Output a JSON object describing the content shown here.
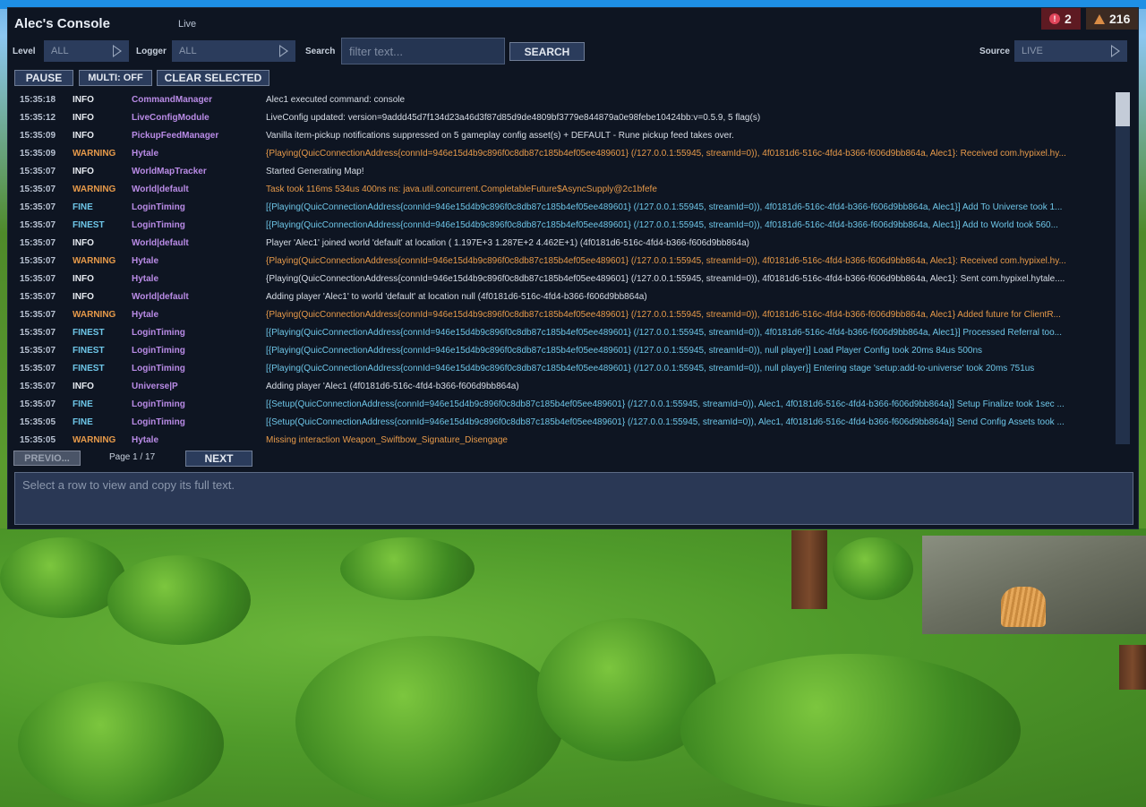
{
  "app": {
    "title": "Alec's Console",
    "status": "Live"
  },
  "badges": {
    "errors": "2",
    "warnings": "216"
  },
  "filters": {
    "level_label": "Level",
    "level_value": "ALL",
    "logger_label": "Logger",
    "logger_value": "ALL",
    "search_label": "Search",
    "search_placeholder": "filter text...",
    "search_button": "SEARCH",
    "source_label": "Source",
    "source_value": "LIVE"
  },
  "toolbar": {
    "pause": "PAUSE",
    "multi": "MULTI: OFF",
    "clear": "CLEAR SELECTED"
  },
  "rows": [
    {
      "time": "15:35:18",
      "level": "INFO",
      "logger": "CommandManager",
      "msg": "Alec1 executed command: console"
    },
    {
      "time": "15:35:12",
      "level": "INFO",
      "logger": "LiveConfigModule",
      "msg": "LiveConfig updated: version=9addd45d7f134d23a46d3f87d85d9de4809bf3779e844879a0e98febe10424bb:v=0.5.9, 5 flag(s)"
    },
    {
      "time": "15:35:09",
      "level": "INFO",
      "logger": "PickupFeedManager",
      "msg": "Vanilla item-pickup notifications suppressed on 5 gameplay config asset(s) + DEFAULT - Rune pickup feed takes over."
    },
    {
      "time": "15:35:09",
      "level": "WARNING",
      "logger": "Hytale",
      "msg": "{Playing(QuicConnectionAddress{connId=946e15d4b9c896f0c8db87c185b4ef05ee489601} (/127.0.0.1:55945, streamId=0)), 4f0181d6-516c-4fd4-b366-f606d9bb864a, Alec1}: Received com.hypixel.hy..."
    },
    {
      "time": "15:35:07",
      "level": "INFO",
      "logger": "WorldMapTracker",
      "msg": "Started Generating Map!"
    },
    {
      "time": "15:35:07",
      "level": "WARNING",
      "logger": "World|default",
      "msg": "Task took 116ms 534us 400ns ns: java.util.concurrent.CompletableFuture$AsyncSupply@2c1bfefe"
    },
    {
      "time": "15:35:07",
      "level": "FINE",
      "logger": "LoginTiming",
      "msg": "[{Playing(QuicConnectionAddress{connId=946e15d4b9c896f0c8db87c185b4ef05ee489601} (/127.0.0.1:55945, streamId=0)), 4f0181d6-516c-4fd4-b366-f606d9bb864a, Alec1}] Add To Universe took 1..."
    },
    {
      "time": "15:35:07",
      "level": "FINEST",
      "logger": "LoginTiming",
      "msg": "[{Playing(QuicConnectionAddress{connId=946e15d4b9c896f0c8db87c185b4ef05ee489601} (/127.0.0.1:55945, streamId=0)), 4f0181d6-516c-4fd4-b366-f606d9bb864a, Alec1}] Add to World took 560..."
    },
    {
      "time": "15:35:07",
      "level": "INFO",
      "logger": "World|default",
      "msg": "Player 'Alec1' joined world 'default' at location ( 1.197E+3  1.287E+2  4.462E+1) (4f0181d6-516c-4fd4-b366-f606d9bb864a)"
    },
    {
      "time": "15:35:07",
      "level": "WARNING",
      "logger": "Hytale",
      "msg": "{Playing(QuicConnectionAddress{connId=946e15d4b9c896f0c8db87c185b4ef05ee489601} (/127.0.0.1:55945, streamId=0)), 4f0181d6-516c-4fd4-b366-f606d9bb864a, Alec1}: Received com.hypixel.hy..."
    },
    {
      "time": "15:35:07",
      "level": "INFO",
      "logger": "Hytale",
      "msg": "{Playing(QuicConnectionAddress{connId=946e15d4b9c896f0c8db87c185b4ef05ee489601} (/127.0.0.1:55945, streamId=0)), 4f0181d6-516c-4fd4-b366-f606d9bb864a, Alec1}: Sent com.hypixel.hytale...."
    },
    {
      "time": "15:35:07",
      "level": "INFO",
      "logger": "World|default",
      "msg": "Adding player 'Alec1' to world 'default' at location null (4f0181d6-516c-4fd4-b366-f606d9bb864a)"
    },
    {
      "time": "15:35:07",
      "level": "WARNING",
      "logger": "Hytale",
      "msg": "{Playing(QuicConnectionAddress{connId=946e15d4b9c896f0c8db87c185b4ef05ee489601} (/127.0.0.1:55945, streamId=0)), 4f0181d6-516c-4fd4-b366-f606d9bb864a, Alec1} Added future for ClientR..."
    },
    {
      "time": "15:35:07",
      "level": "FINEST",
      "logger": "LoginTiming",
      "msg": "[{Playing(QuicConnectionAddress{connId=946e15d4b9c896f0c8db87c185b4ef05ee489601} (/127.0.0.1:55945, streamId=0)), 4f0181d6-516c-4fd4-b366-f606d9bb864a, Alec1}] Processed Referral too..."
    },
    {
      "time": "15:35:07",
      "level": "FINEST",
      "logger": "LoginTiming",
      "msg": "[{Playing(QuicConnectionAddress{connId=946e15d4b9c896f0c8db87c185b4ef05ee489601} (/127.0.0.1:55945, streamId=0)), null player}] Load Player Config took 20ms 84us 500ns"
    },
    {
      "time": "15:35:07",
      "level": "FINEST",
      "logger": "LoginTiming",
      "msg": "[{Playing(QuicConnectionAddress{connId=946e15d4b9c896f0c8db87c185b4ef05ee489601} (/127.0.0.1:55945, streamId=0)), null player}] Entering stage 'setup:add-to-universe' took 20ms 751us"
    },
    {
      "time": "15:35:07",
      "level": "INFO",
      "logger": "Universe|P",
      "msg": "Adding player 'Alec1 (4f0181d6-516c-4fd4-b366-f606d9bb864a)"
    },
    {
      "time": "15:35:07",
      "level": "FINE",
      "logger": "LoginTiming",
      "msg": "[{Setup(QuicConnectionAddress{connId=946e15d4b9c896f0c8db87c185b4ef05ee489601} (/127.0.0.1:55945, streamId=0)), Alec1, 4f0181d6-516c-4fd4-b366-f606d9bb864a}] Setup Finalize took 1sec ..."
    },
    {
      "time": "15:35:05",
      "level": "FINE",
      "logger": "LoginTiming",
      "msg": "[{Setup(QuicConnectionAddress{connId=946e15d4b9c896f0c8db87c185b4ef05ee489601} (/127.0.0.1:55945, streamId=0)), Alec1, 4f0181d6-516c-4fd4-b366-f606d9bb864a}] Send Config Assets took ..."
    },
    {
      "time": "15:35:05",
      "level": "WARNING",
      "logger": "Hytale",
      "msg": "Missing interaction Weapon_Swiftbow_Signature_Disengage"
    }
  ],
  "pager": {
    "prev": "PREVIO...",
    "label": "Page 1 / 17",
    "next": "NEXT"
  },
  "detail": {
    "placeholder": "Select a row to view and copy its full text."
  },
  "icons": {
    "errors": "error-circle-icon",
    "warnings": "warning-triangle-icon",
    "dropdown": "triangle-right-icon"
  }
}
